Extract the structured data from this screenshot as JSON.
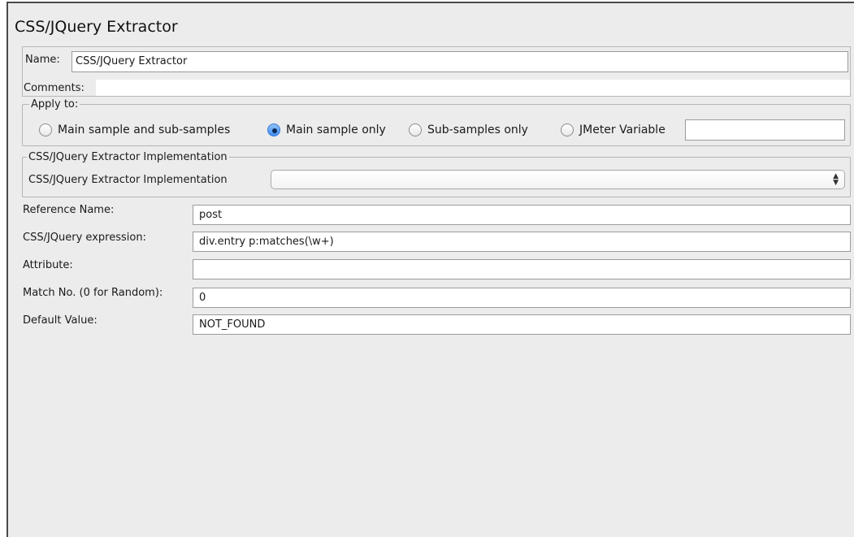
{
  "panel": {
    "title": "CSS/JQuery Extractor"
  },
  "name_field": {
    "label": "Name:",
    "value": "CSS/JQuery Extractor"
  },
  "comments": {
    "label": "Comments:",
    "value": ""
  },
  "apply_to": {
    "legend": "Apply to:",
    "options": [
      {
        "label": "Main sample and sub-samples",
        "selected": false
      },
      {
        "label": "Main sample only",
        "selected": true
      },
      {
        "label": "Sub-samples only",
        "selected": false
      },
      {
        "label": "JMeter Variable",
        "selected": false
      }
    ],
    "jmeter_variable_value": ""
  },
  "implementation": {
    "legend": "CSS/JQuery Extractor Implementation",
    "label": "CSS/JQuery Extractor Implementation",
    "selected": ""
  },
  "fields": [
    {
      "label": "Reference Name:",
      "value": "post"
    },
    {
      "label": "CSS/JQuery expression:",
      "value": "div.entry p:matches(\\w+)"
    },
    {
      "label": "Attribute:",
      "value": ""
    },
    {
      "label": "Match No. (0 for Random):",
      "value": "0"
    },
    {
      "label": "Default Value:",
      "value": "NOT_FOUND"
    }
  ],
  "icons": {
    "select_arrow": "up-down-chevron-icon",
    "radio": "radio-button-icon"
  },
  "colors": {
    "panel_background": "#ececec",
    "radio_selected": "#3e8df0",
    "input_background": "#ffffff"
  }
}
